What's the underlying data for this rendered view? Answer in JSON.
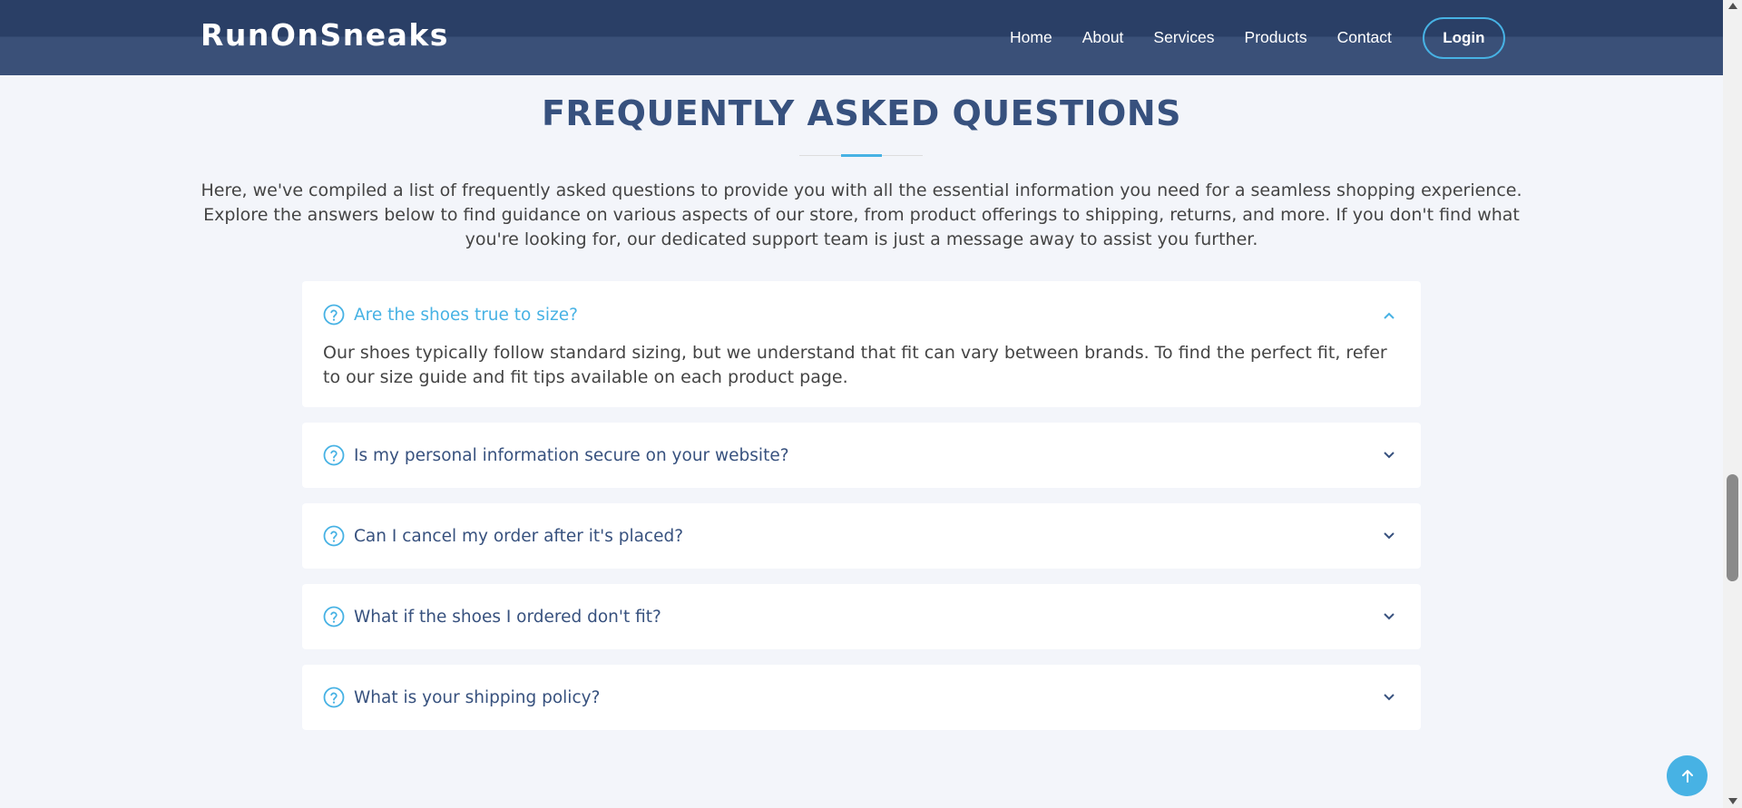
{
  "header": {
    "logo": "RunOnSneaks",
    "nav": [
      "Home",
      "About",
      "Services",
      "Products",
      "Contact"
    ],
    "login_label": "Login"
  },
  "faq": {
    "title": "FREQUENTLY ASKED QUESTIONS",
    "intro": "Here, we've compiled a list of frequently asked questions to provide you with all the essential information you need for a seamless shopping experience. Explore the answers below to find guidance on various aspects of our store, from product offerings to shipping, returns, and more. If you don't find what you're looking for, our dedicated support team is just a message away to assist you further.",
    "items": [
      {
        "question": "Are the shoes true to size?",
        "answer": "Our shoes typically follow standard sizing, but we understand that fit can vary between brands. To find the perfect fit, refer to our size guide and fit tips available on each product page.",
        "expanded": true
      },
      {
        "question": "Is my personal information secure on your website?",
        "expanded": false
      },
      {
        "question": "Can I cancel my order after it's placed?",
        "expanded": false
      },
      {
        "question": "What if the shoes I ordered don't fit?",
        "expanded": false
      },
      {
        "question": "What is your shipping policy?",
        "expanded": false
      }
    ]
  },
  "colors": {
    "header_bg": "#2a3f66",
    "heading": "#37517e",
    "accent": "#47b2e4",
    "page_bg": "#f3f5fa"
  },
  "icons": {
    "question": "question-circle-icon",
    "chevron_up": "chevron-up-icon",
    "chevron_down": "chevron-down-icon",
    "back_to_top": "arrow-up-icon"
  }
}
